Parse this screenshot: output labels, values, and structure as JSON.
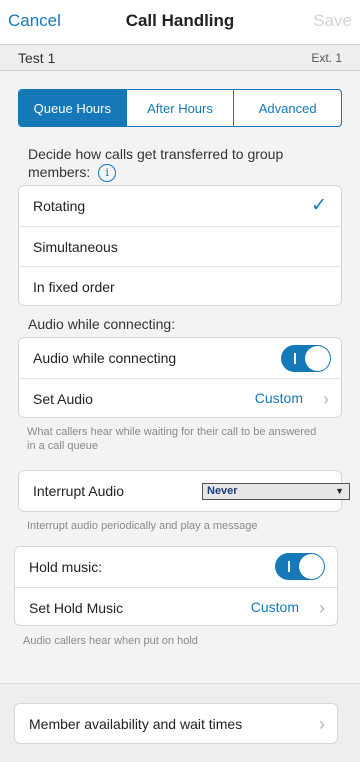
{
  "nav": {
    "cancel": "Cancel",
    "title": "Call Handling",
    "save": "Save"
  },
  "context": {
    "name": "Test 1",
    "ext": "Ext. 1"
  },
  "tabs": [
    {
      "label": "Queue Hours",
      "active": true
    },
    {
      "label": "After Hours",
      "active": false
    },
    {
      "label": "Advanced",
      "active": false
    }
  ],
  "transfer": {
    "description": "Decide how calls get transferred to group members:",
    "info_icon": "info-icon",
    "options": [
      "Rotating",
      "Simultaneous",
      "In fixed order"
    ],
    "selected": "Rotating"
  },
  "audio": {
    "section_label": "Audio while connecting:",
    "toggle_label": "Audio while connecting",
    "toggle_on": true,
    "set_audio_label": "Set Audio",
    "set_audio_value": "Custom",
    "helper": "What callers hear while waiting for their call to be answered in a call queue"
  },
  "interrupt": {
    "label": "Interrupt Audio",
    "value": "Never",
    "helper": "Interrupt audio periodically and play a message"
  },
  "hold": {
    "toggle_label": "Hold music:",
    "toggle_on": true,
    "set_label": "Set Hold Music",
    "set_value": "Custom",
    "helper": "Audio callers hear when put on hold"
  },
  "member": {
    "label": "Member availability and wait times"
  },
  "colors": {
    "accent": "#1478b9",
    "background": "#f3f3f3"
  }
}
